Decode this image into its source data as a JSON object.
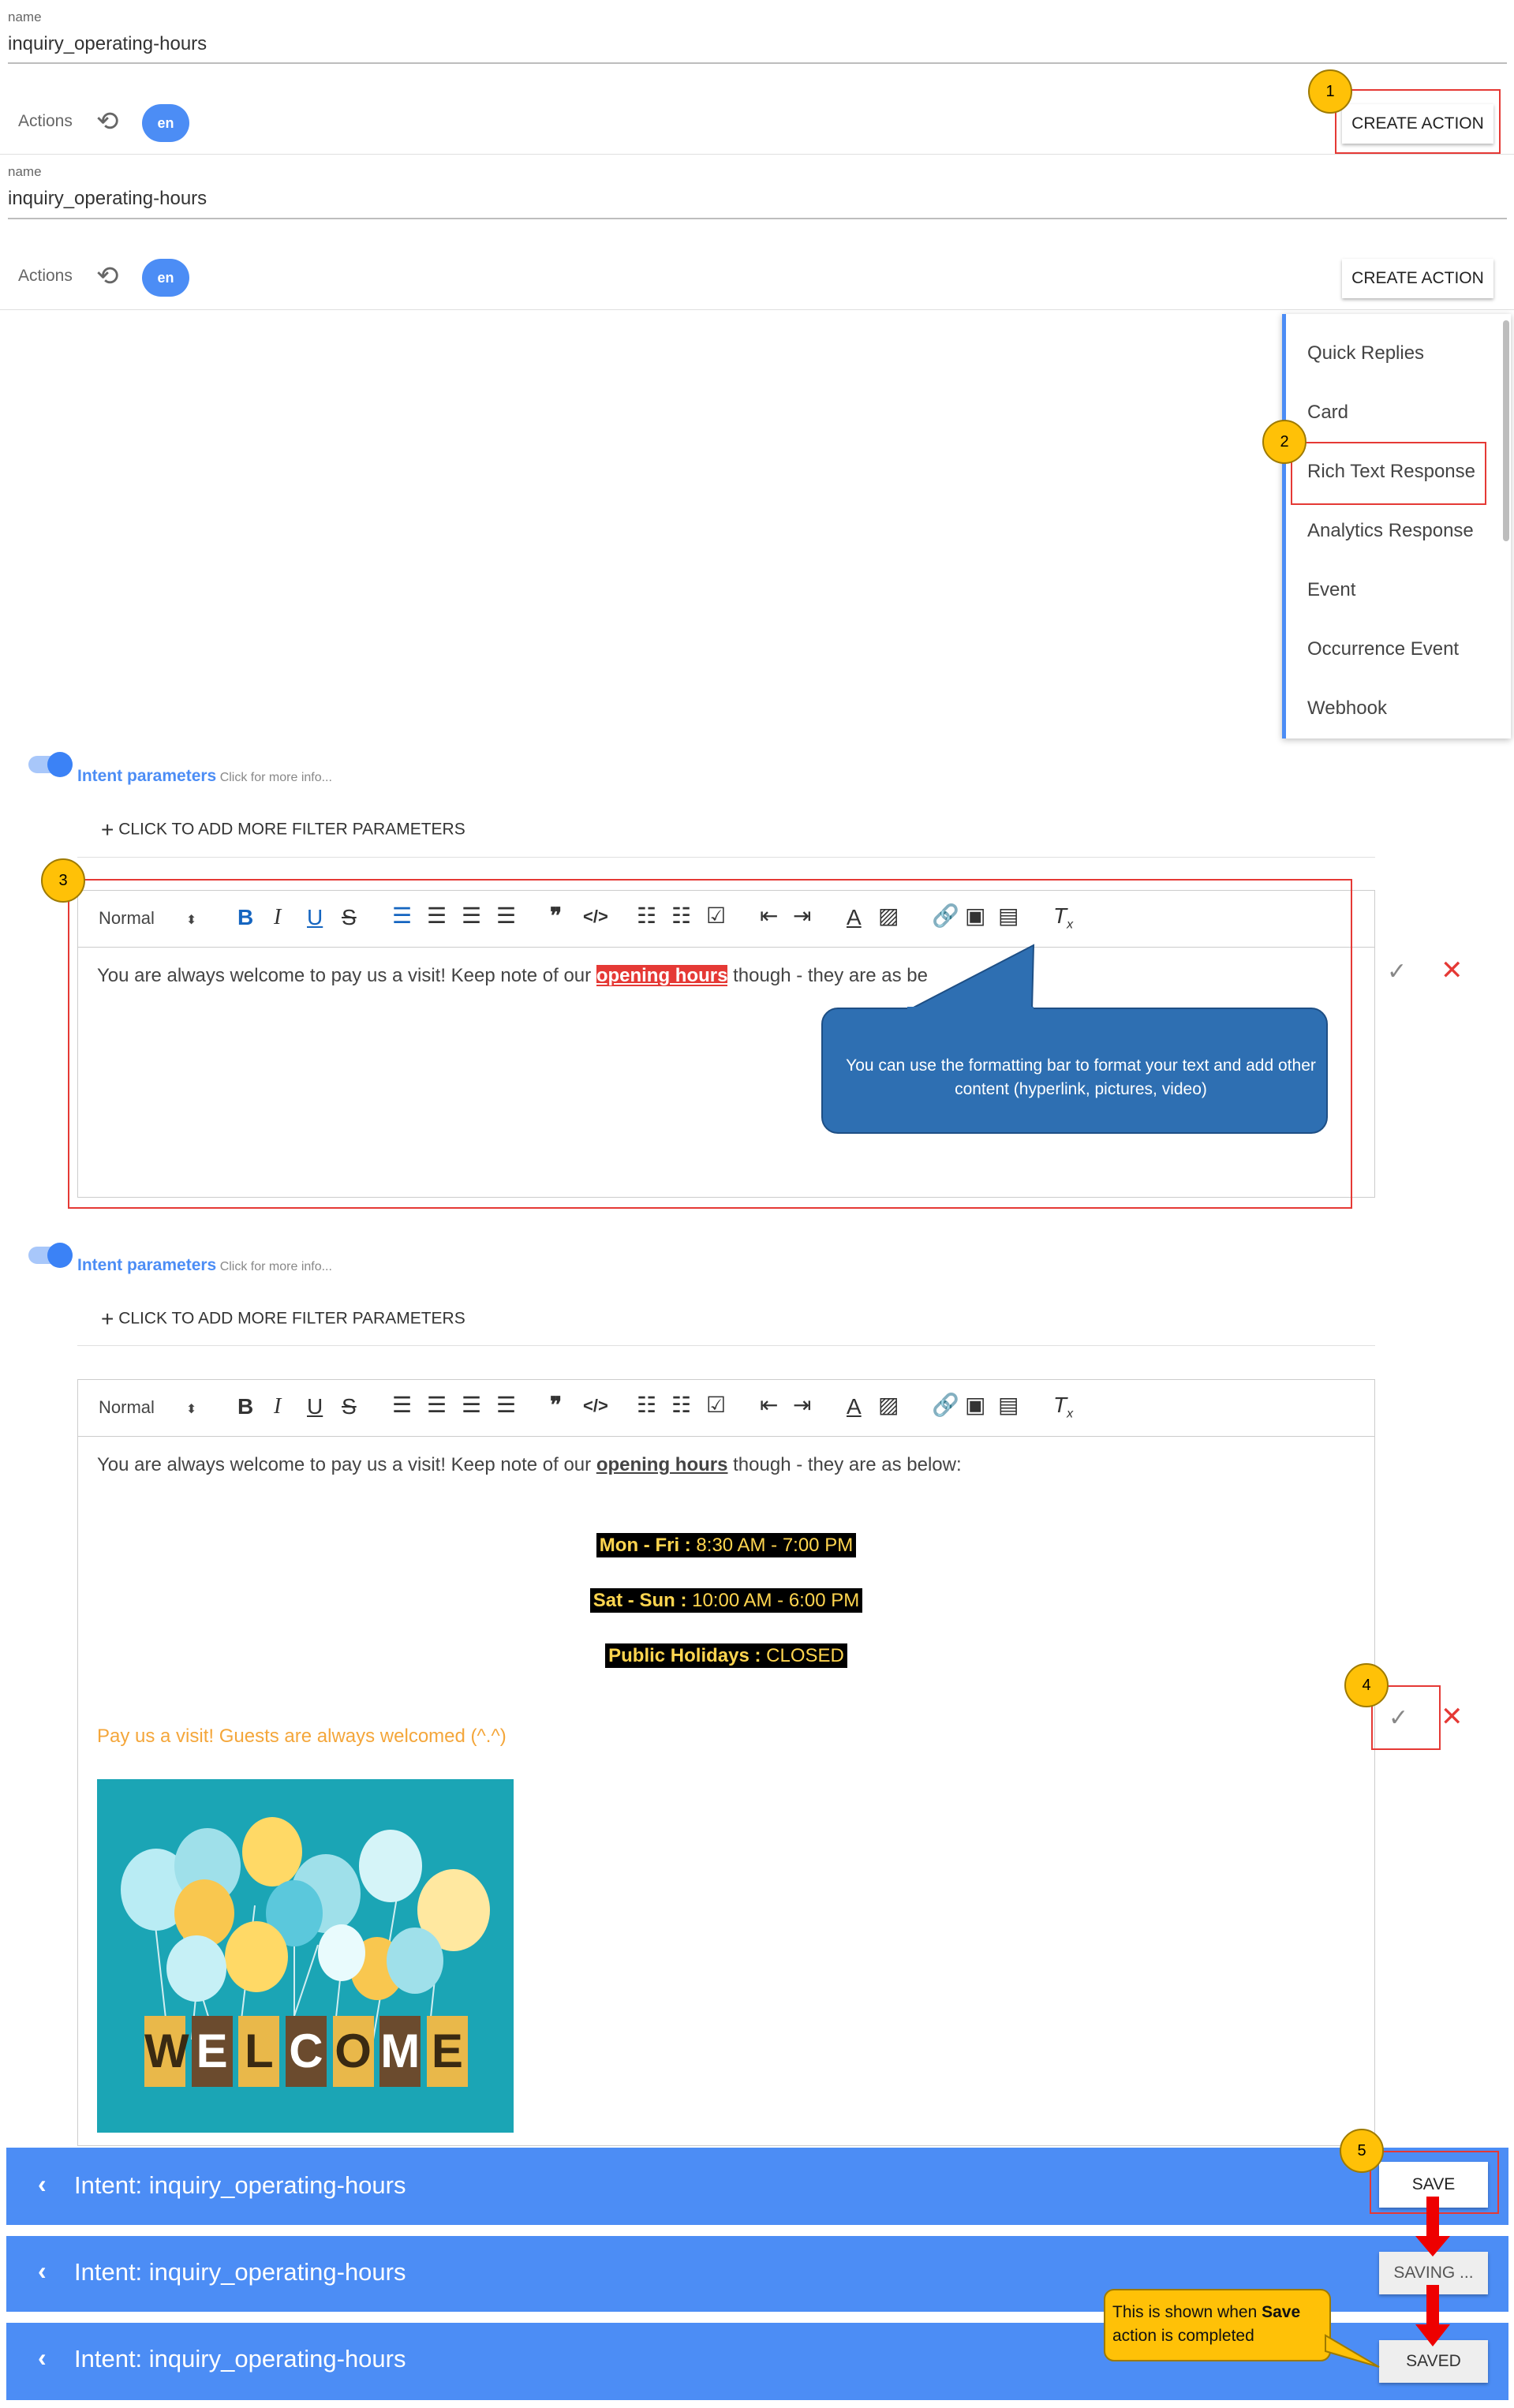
{
  "panel1": {
    "name_label": "name",
    "name_value": "inquiry_operating-hours",
    "actions_label": "Actions",
    "lang": "en",
    "create_action": "CREATE ACTION",
    "badge": "1"
  },
  "panel2": {
    "name_label": "name",
    "name_value": "inquiry_operating-hours",
    "actions_label": "Actions",
    "lang": "en",
    "create_action": "CREATE ACTION"
  },
  "menu": {
    "badge": "2",
    "items": [
      "Quick Replies",
      "Card",
      "Rich Text Response",
      "Analytics Response",
      "Event",
      "Occurrence Event",
      "Webhook"
    ]
  },
  "editor1": {
    "badge": "3",
    "intent_label": "Intent parameters",
    "intent_sub": "Click for more info...",
    "add_filter": "CLICK TO ADD MORE FILTER PARAMETERS",
    "style_select": "Normal",
    "text_a": "You are always welcome to pay us a visit! Keep note of our ",
    "text_hl": "opening hours",
    "text_b": " though - they are as be",
    "callout": "You can use the formatting bar to format your text and add other content (hyperlink, pictures, video)"
  },
  "editor2": {
    "badge": "4",
    "intent_label": "Intent parameters",
    "intent_sub": "Click for more info...",
    "add_filter": "CLICK TO ADD MORE FILTER PARAMETERS",
    "style_select": "Normal",
    "text_a": "You are always welcome to pay us a visit! Keep note of our ",
    "text_hl": "opening hours",
    "text_b": " though - they are as below:",
    "hours": [
      {
        "label": "Mon - Fri :",
        "value": " 8:30 AM - 7:00 PM"
      },
      {
        "label": "Sat - Sun :",
        "value": " 10:00 AM - 6:00 PM"
      },
      {
        "label": "Public Holidays :",
        "value": " CLOSED"
      }
    ],
    "welcome_line": "Pay us a visit! Guests are always welcomed (^.^)",
    "welcome_letters": [
      "W",
      "E",
      "L",
      "C",
      "O",
      "M",
      "E"
    ]
  },
  "bars": {
    "badge": "5",
    "title": "Intent: inquiry_operating-hours",
    "save": "SAVE",
    "saving": "SAVING ...",
    "saved": "SAVED",
    "note_a": "This is shown when ",
    "note_bold": "Save",
    "note_b": " action is completed"
  },
  "colors": {
    "accent": "#4c8df5",
    "badge": "#ffc107",
    "callout": "#2e6fb2",
    "red": "#e53935",
    "hours_text": "#ffd54f"
  }
}
